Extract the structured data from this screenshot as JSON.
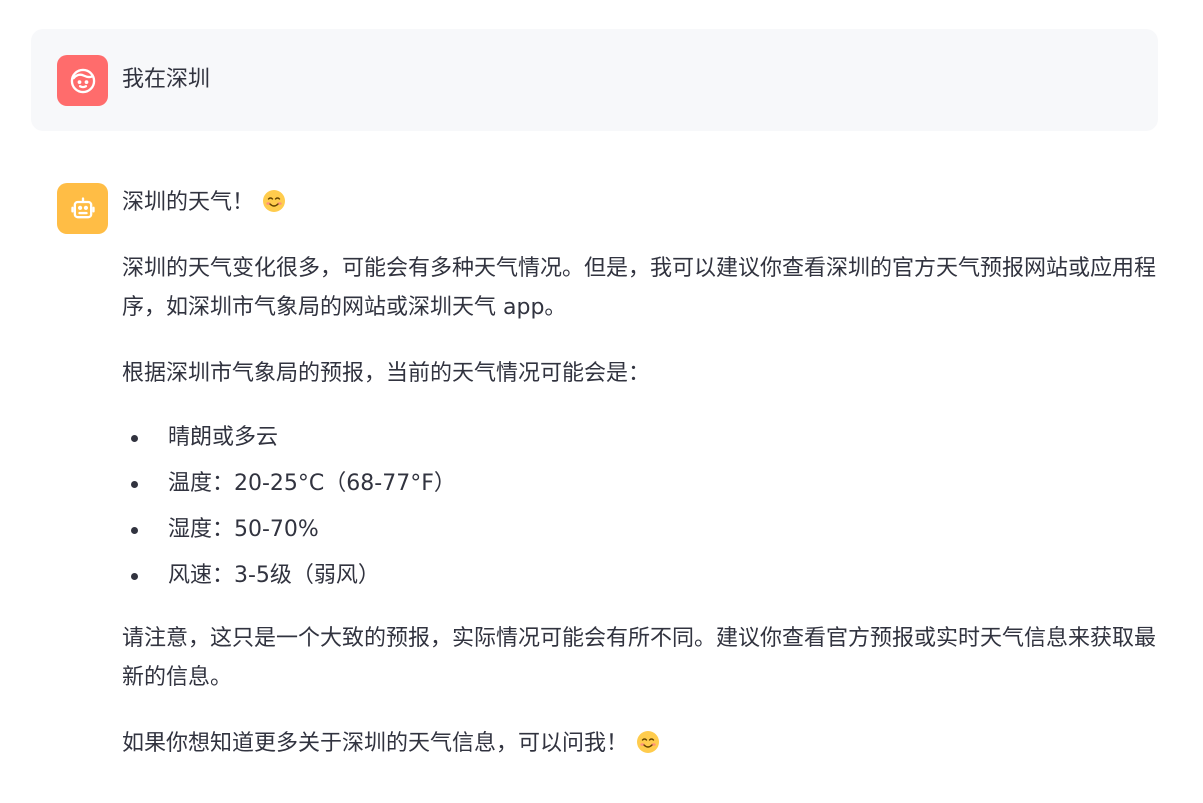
{
  "user_message": {
    "text": "我在深圳",
    "avatar_icon": "smiling-face-icon",
    "avatar_color": "#ff6c6c"
  },
  "assistant_message": {
    "avatar_icon": "robot-icon",
    "avatar_color": "#ffbd45",
    "heading": "深圳的天气！",
    "heading_emoji": "smiling-face-emoji",
    "paragraph_1": "深圳的天气变化很多，可能会有多种天气情况。但是，我可以建议你查看深圳的官方天气预报网站或应用程序，如深圳市气象局的网站或深圳天气 app。",
    "paragraph_2": "根据深圳市气象局的预报，当前的天气情况可能会是：",
    "bullets": [
      "晴朗或多云",
      "温度：20-25°C（68-77°F）",
      "湿度：50-70%",
      "风速：3-5级（弱风）"
    ],
    "paragraph_3": "请注意，这只是一个大致的预报，实际情况可能会有所不同。建议你查看官方预报或实时天气信息来获取最新的信息。",
    "paragraph_4": "如果你想知道更多关于深圳的天气信息，可以问我！",
    "closing_emoji": "smiling-face-emoji"
  }
}
